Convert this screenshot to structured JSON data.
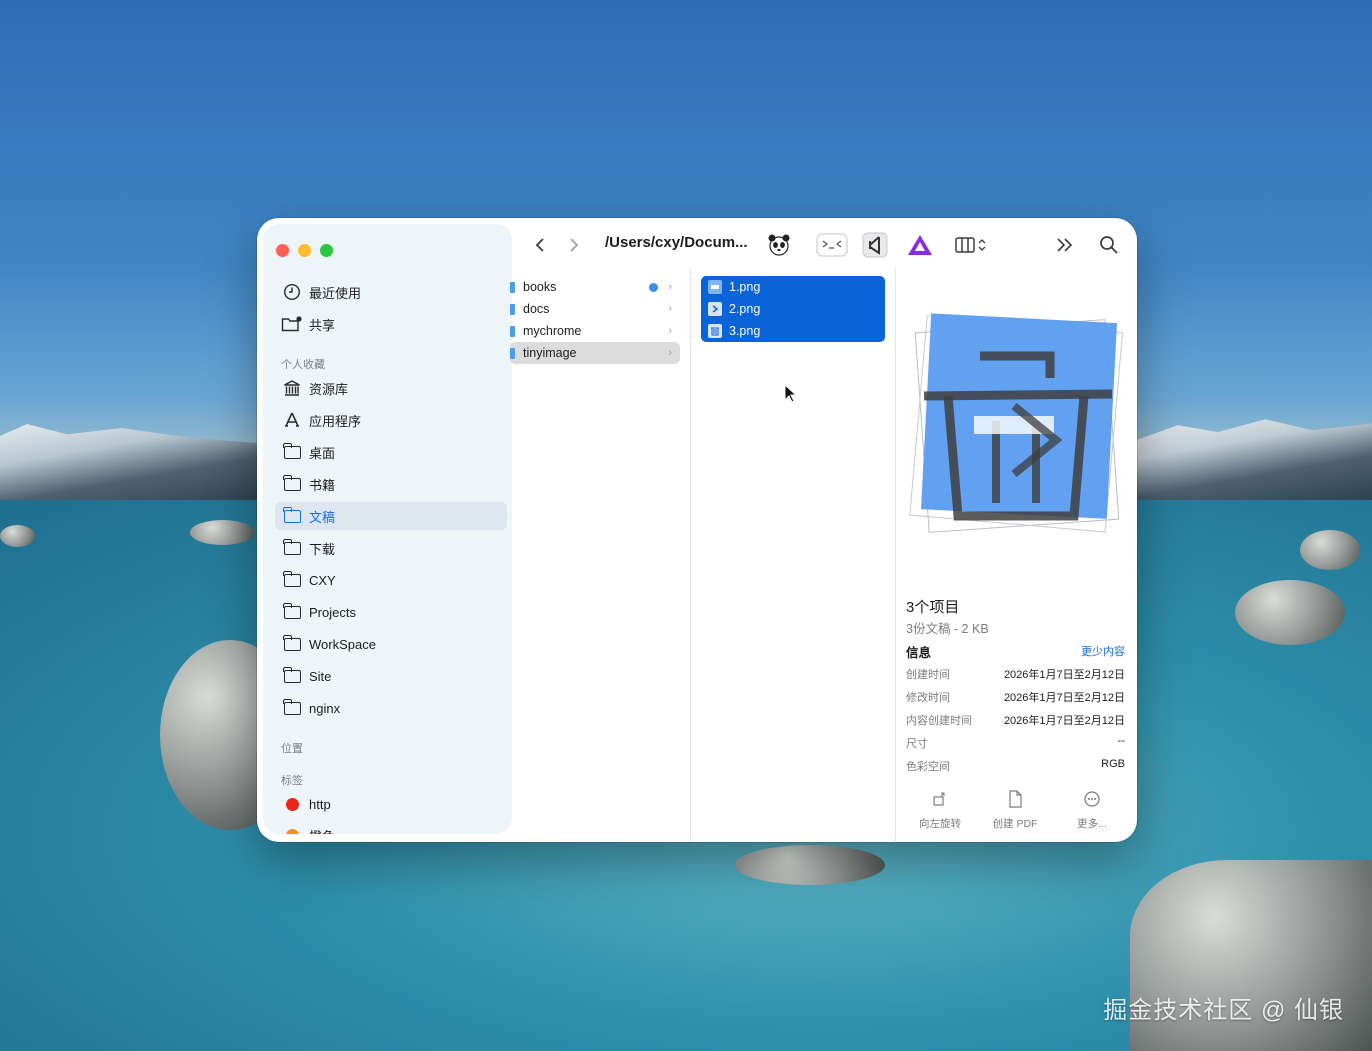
{
  "window": {
    "path": "/Users/cxy/Docum..."
  },
  "sidebar": {
    "top_items": [
      {
        "label": "最近使用",
        "icon": "clock-icon"
      },
      {
        "label": "共享",
        "icon": "shared-folder-icon"
      }
    ],
    "favorites_header": "个人收藏",
    "favorites": [
      {
        "label": "资源库",
        "icon": "library-icon"
      },
      {
        "label": "应用程序",
        "icon": "apps-icon"
      },
      {
        "label": "桌面",
        "icon": "folder-icon"
      },
      {
        "label": "书籍",
        "icon": "folder-icon"
      },
      {
        "label": "文稿",
        "icon": "folder-icon",
        "active": true
      },
      {
        "label": "下载",
        "icon": "folder-icon"
      },
      {
        "label": "CXY",
        "icon": "folder-icon"
      },
      {
        "label": "Projects",
        "icon": "folder-icon"
      },
      {
        "label": "WorkSpace",
        "icon": "folder-icon"
      },
      {
        "label": "Site",
        "icon": "folder-icon"
      },
      {
        "label": "nginx",
        "icon": "folder-icon"
      }
    ],
    "locations_header": "位置",
    "tags_header": "标签",
    "tags": [
      {
        "label": "http",
        "color": "#e8241b"
      },
      {
        "label": "橙色",
        "color": "#f5921e"
      }
    ]
  },
  "column1": [
    {
      "name": "books",
      "has_dot": true
    },
    {
      "name": "docs"
    },
    {
      "name": "mychrome"
    },
    {
      "name": "tinyimage",
      "selected": true
    }
  ],
  "column2": [
    {
      "name": "1.png",
      "icon": "image-doc-icon"
    },
    {
      "name": "2.png",
      "icon": "terminal-doc-icon"
    },
    {
      "name": "3.png",
      "icon": "trash-doc-icon"
    }
  ],
  "info": {
    "title": "3个项目",
    "subtitle": "3份文稿 - 2 KB",
    "heading": "信息",
    "less_link": "更少内容",
    "rows": [
      {
        "key": "创建时间",
        "value": "2026年1月7日至2月12日"
      },
      {
        "key": "修改时间",
        "value": "2026年1月7日至2月12日"
      },
      {
        "key": "内容创建时间",
        "value": "2026年1月7日至2月12日"
      },
      {
        "key": "尺寸",
        "value": "--"
      },
      {
        "key": "色彩空间",
        "value": "RGB"
      }
    ],
    "actions": [
      {
        "label": "向左旋转",
        "icon": "rotate-left-icon"
      },
      {
        "label": "创建 PDF",
        "icon": "create-pdf-icon"
      },
      {
        "label": "更多...",
        "icon": "more-icon"
      }
    ]
  },
  "watermark": "掘金技术社区 @ 仙银",
  "colors": {
    "accent": "#1a6fe0",
    "selection": "#0a64d8"
  }
}
